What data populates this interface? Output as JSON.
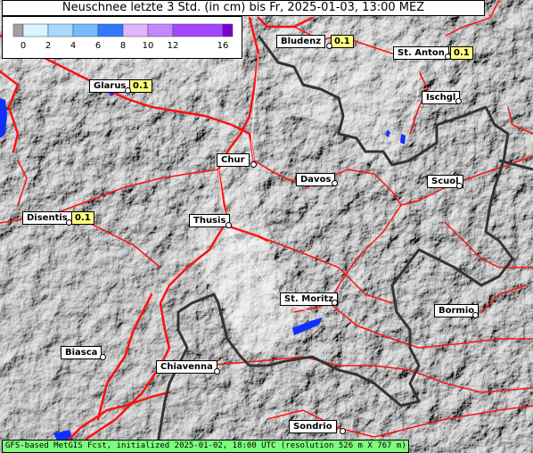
{
  "title": "Neuschnee letzte 3 Std. (in cm) bis Fr, 2025-01-03, 13:00 MEZ",
  "legend": {
    "ticks": [
      "0",
      "2",
      "4",
      "6",
      "8",
      "10",
      "12",
      "16"
    ],
    "colors": [
      "#a0a0a0",
      "#d8f4ff",
      "#a9d9ff",
      "#76b9ff",
      "#2f79ff",
      "#e0b6ff",
      "#c587ff",
      "#a248ff",
      "#7c00d0"
    ]
  },
  "places": [
    {
      "name": "Bludenz",
      "value": "0.1"
    },
    {
      "name": "St. Anton",
      "value": "0.1"
    },
    {
      "name": "Glarus",
      "value": "0.1"
    },
    {
      "name": "Ischgl"
    },
    {
      "name": "Chur"
    },
    {
      "name": "Davos"
    },
    {
      "name": "Scuol"
    },
    {
      "name": "Disentis",
      "value": "0.1"
    },
    {
      "name": "Thusis"
    },
    {
      "name": "St. Moritz"
    },
    {
      "name": "Bormio"
    },
    {
      "name": "Biasca"
    },
    {
      "name": "Chiavenna"
    },
    {
      "name": "Sondrio"
    }
  ],
  "footer": "GFS-based MetGIS Fcst, initialized 2025-01-02, 18:00 UTC  (resolution 526 m X 767 m)"
}
